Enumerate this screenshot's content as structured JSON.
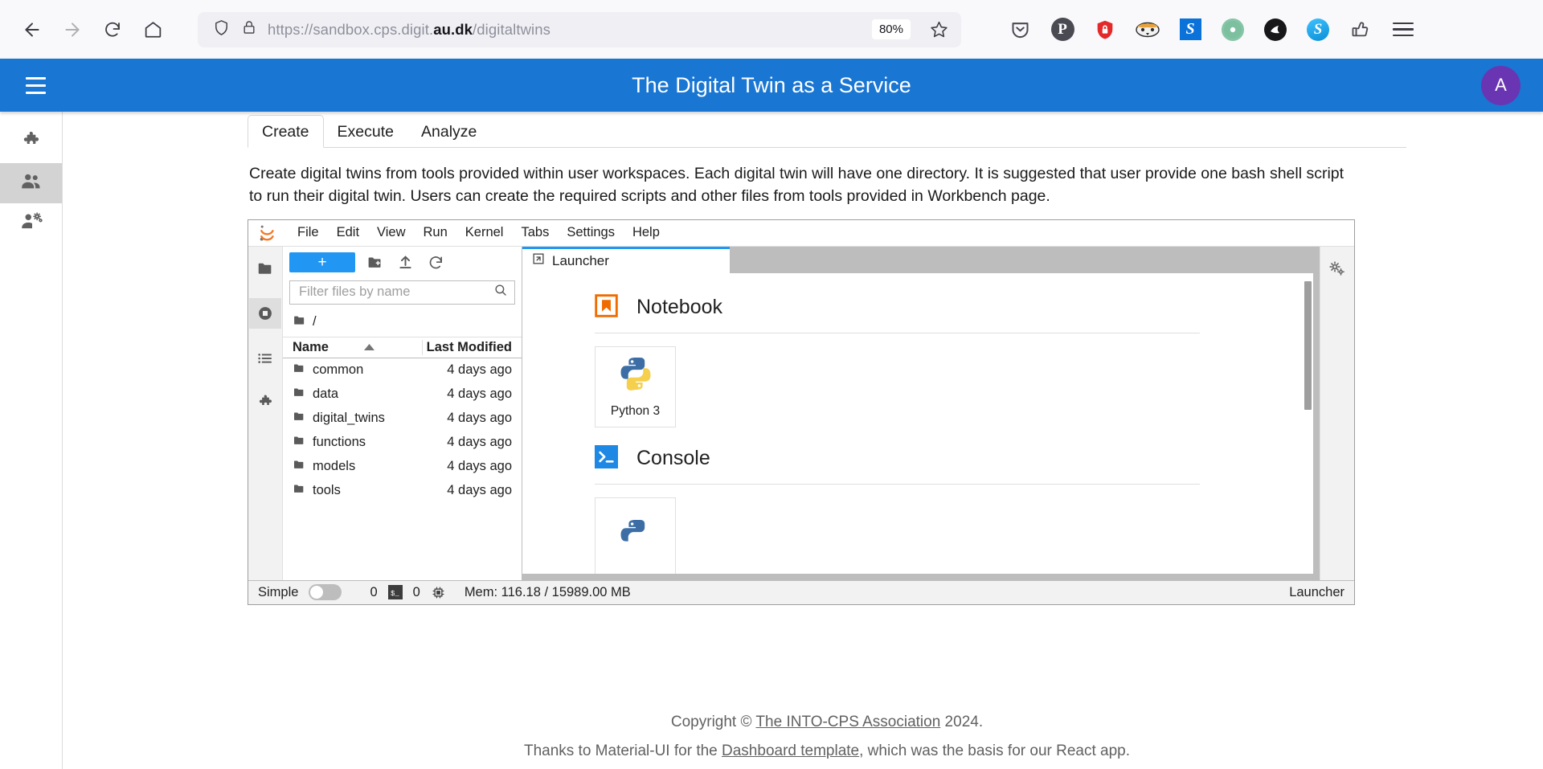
{
  "browser": {
    "back_label": "Back",
    "forward_label": "Forward",
    "reload_label": "Reload",
    "home_label": "Home",
    "url_prefix": "https://sandbox.cps.digit.",
    "url_domain": "au.dk",
    "url_suffix": "/digitaltwins",
    "zoom_level": "80%",
    "bookmark_label": "Bookmark this page",
    "extensions": [
      {
        "name": "pocket-icon",
        "glyph": ""
      },
      {
        "name": "p-extension-icon",
        "glyph": "P"
      },
      {
        "name": "shield-lock-extension-icon",
        "glyph": ""
      },
      {
        "name": "badger-extension-icon",
        "glyph": ""
      },
      {
        "name": "s-blue-extension-icon",
        "glyph": "S"
      },
      {
        "name": "green-circle-extension-icon",
        "glyph": ""
      },
      {
        "name": "black-circle-extension-icon",
        "glyph": ""
      },
      {
        "name": "skype-extension-icon",
        "glyph": "S"
      },
      {
        "name": "thumb-extension-icon",
        "glyph": ""
      }
    ],
    "app_menu_label": "Open application menu"
  },
  "app": {
    "title": "The Digital Twin as a Service",
    "menu_label": "Open drawer",
    "avatar_initial": "A",
    "accent_color": "#1976d2",
    "avatar_color": "#6a35b3"
  },
  "sidebar": {
    "items": [
      {
        "name": "sidebar-item-workbench",
        "icon": "puzzle-piece-icon",
        "active": false
      },
      {
        "name": "sidebar-item-digital-twins",
        "icon": "people-icon",
        "active": true
      },
      {
        "name": "sidebar-item-manage",
        "icon": "person-gear-icon",
        "active": false
      }
    ]
  },
  "main": {
    "tabs": [
      {
        "label": "Create",
        "active": true
      },
      {
        "label": "Execute",
        "active": false
      },
      {
        "label": "Analyze",
        "active": false
      }
    ],
    "description": "Create digital twins from tools provided within user workspaces. Each digital twin will have one directory. It is suggested that user provide one bash shell script to run their digital twin. Users can create the required scripts and other files from tools provided in Workbench page."
  },
  "jupyter": {
    "menu": [
      "File",
      "Edit",
      "View",
      "Run",
      "Kernel",
      "Tabs",
      "Settings",
      "Help"
    ],
    "filebrowser": {
      "new_button_label": "+",
      "new_folder_label": "New Folder",
      "upload_label": "Upload Files",
      "refresh_label": "Refresh File List",
      "filter_placeholder": "Filter files by name",
      "filter_value": "",
      "breadcrumb_root": "/",
      "columns": [
        "Name",
        "Last Modified"
      ],
      "sort_indicator": "ascending",
      "rows": [
        {
          "name": "common",
          "modified": "4 days ago"
        },
        {
          "name": "data",
          "modified": "4 days ago"
        },
        {
          "name": "digital_twins",
          "modified": "4 days ago"
        },
        {
          "name": "functions",
          "modified": "4 days ago"
        },
        {
          "name": "models",
          "modified": "4 days ago"
        },
        {
          "name": "tools",
          "modified": "4 days ago"
        }
      ]
    },
    "dock_tab": "Launcher",
    "launcher": {
      "sections": [
        {
          "title": "Notebook",
          "icon": "notebook-bookmark-icon",
          "cards": [
            {
              "label": "Python 3",
              "icon": "python-logo-icon"
            }
          ]
        },
        {
          "title": "Console",
          "icon": "console-terminal-icon",
          "cards": [
            {
              "label": "",
              "icon": "python-logo-icon"
            }
          ]
        }
      ]
    },
    "statusbar": {
      "simple_label": "Simple",
      "simple_on": false,
      "kernel_count": "0",
      "terminal_count": "0",
      "memory": "Mem: 116.18 / 15989.00 MB",
      "right_label": "Launcher"
    }
  },
  "footer": {
    "copyright_prefix": "Copyright © ",
    "copyright_link": "The INTO-CPS Association",
    "copyright_suffix": " 2024.",
    "thanks_prefix": "Thanks to Material-UI for the ",
    "thanks_link": "Dashboard template",
    "thanks_suffix": ", which was the basis for our React app."
  }
}
